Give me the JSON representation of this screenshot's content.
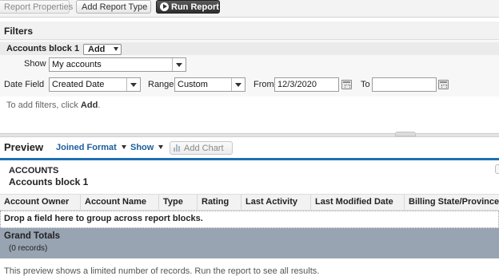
{
  "toolbar": {
    "report_properties": "Report Properties",
    "add_report_type": "Add Report Type",
    "run_report": "Run Report"
  },
  "filters": {
    "title": "Filters",
    "block_name": "Accounts block 1",
    "add_menu": "Add",
    "show_label": "Show",
    "show_value": "My accounts",
    "date_field_label": "Date Field",
    "date_field_value": "Created Date",
    "range_label": "Range",
    "range_value": "Custom",
    "from_label": "From",
    "from_value": "12/3/2020",
    "to_label": "To",
    "to_value": "",
    "hint_prefix": "To add filters, click ",
    "hint_action": "Add",
    "hint_suffix": "."
  },
  "preview": {
    "title": "Preview",
    "joined_format": "Joined Format",
    "show_menu": "Show",
    "add_chart": "Add Chart",
    "block_type": "ACCOUNTS",
    "block_name": "Accounts block 1",
    "columns": [
      "Account Owner",
      "Account Name",
      "Type",
      "Rating",
      "Last Activity",
      "Last Modified Date",
      "Billing State/Province"
    ],
    "drop_hint": "Drop a field here to group across report blocks.",
    "grand_totals": "Grand Totals",
    "record_count": "(0 records)",
    "footer_note": "This preview shows a limited number of records. Run the report to see all results."
  },
  "colors": {
    "accent_blue": "#1f6fb5",
    "link_blue": "#1a5e9c",
    "grand_totals_bg": "#98a4b2"
  }
}
